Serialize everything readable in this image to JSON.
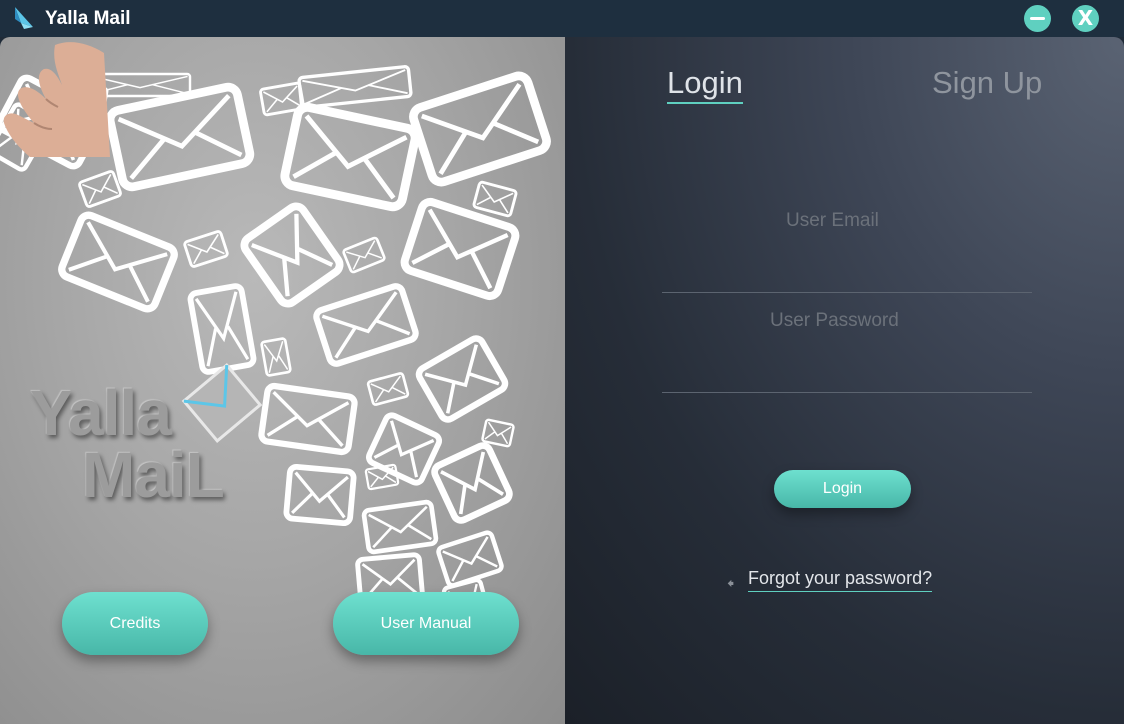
{
  "window": {
    "title": "Yalla Mail",
    "minimize_icon": "minus-icon",
    "close_icon": "close-icon",
    "close_glyph": "X",
    "accent": "#5fd0c0"
  },
  "left": {
    "brand_line1": "Yalla",
    "brand_line2": "MaiL",
    "credits_label": "Credits",
    "manual_label": "User Manual"
  },
  "right": {
    "tabs": [
      {
        "label": "Login",
        "active": true
      },
      {
        "label": "Sign Up",
        "active": false
      }
    ],
    "email_label": "User Email",
    "password_label": "User Password",
    "email_value": "",
    "password_value": "",
    "login_label": "Login",
    "forgot_icon": "arrow-left-icon",
    "forgot_label": "Forgot your password?"
  }
}
